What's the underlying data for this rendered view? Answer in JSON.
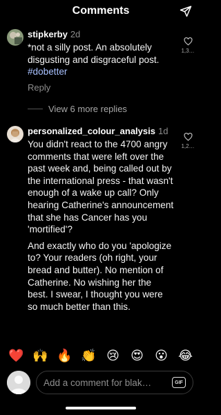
{
  "header": {
    "title": "Comments",
    "send_icon": "send-icon"
  },
  "comments": [
    {
      "username": "stipkerby",
      "time": "2d",
      "text": "*not a silly post. An absolutely disgusting and disgraceful post. ",
      "hashtag": "#dobetter",
      "reply_label": "Reply",
      "likes": "1,3…"
    },
    {
      "username": "personalized_colour_analysis",
      "time": "1d",
      "paragraph1": "You didn't react to the 4700 angry comments that were left over the past week and, being called out by the international press - that wasn't enough of a wake up call? Only hearing Catherine's announcement that she has Cancer has you 'mortified'?",
      "paragraph2": "And exactly who do you 'apologize to? Your readers (oh right, your bread and butter). No mention of Catherine. No wishing her the best. I swear, I thought you were so much better than this.",
      "likes": "1,2…"
    }
  ],
  "view_replies": "View 6 more replies",
  "emojis": [
    "❤️",
    "🙌",
    "🔥",
    "👏",
    "😢",
    "😍",
    "😮",
    "😂"
  ],
  "composer": {
    "placeholder": "Add a comment for blak…",
    "gif_label": "GIF"
  },
  "colors": {
    "background": "#000000",
    "hashtag": "#a8c1ff",
    "muted": "#8e8e8e"
  }
}
